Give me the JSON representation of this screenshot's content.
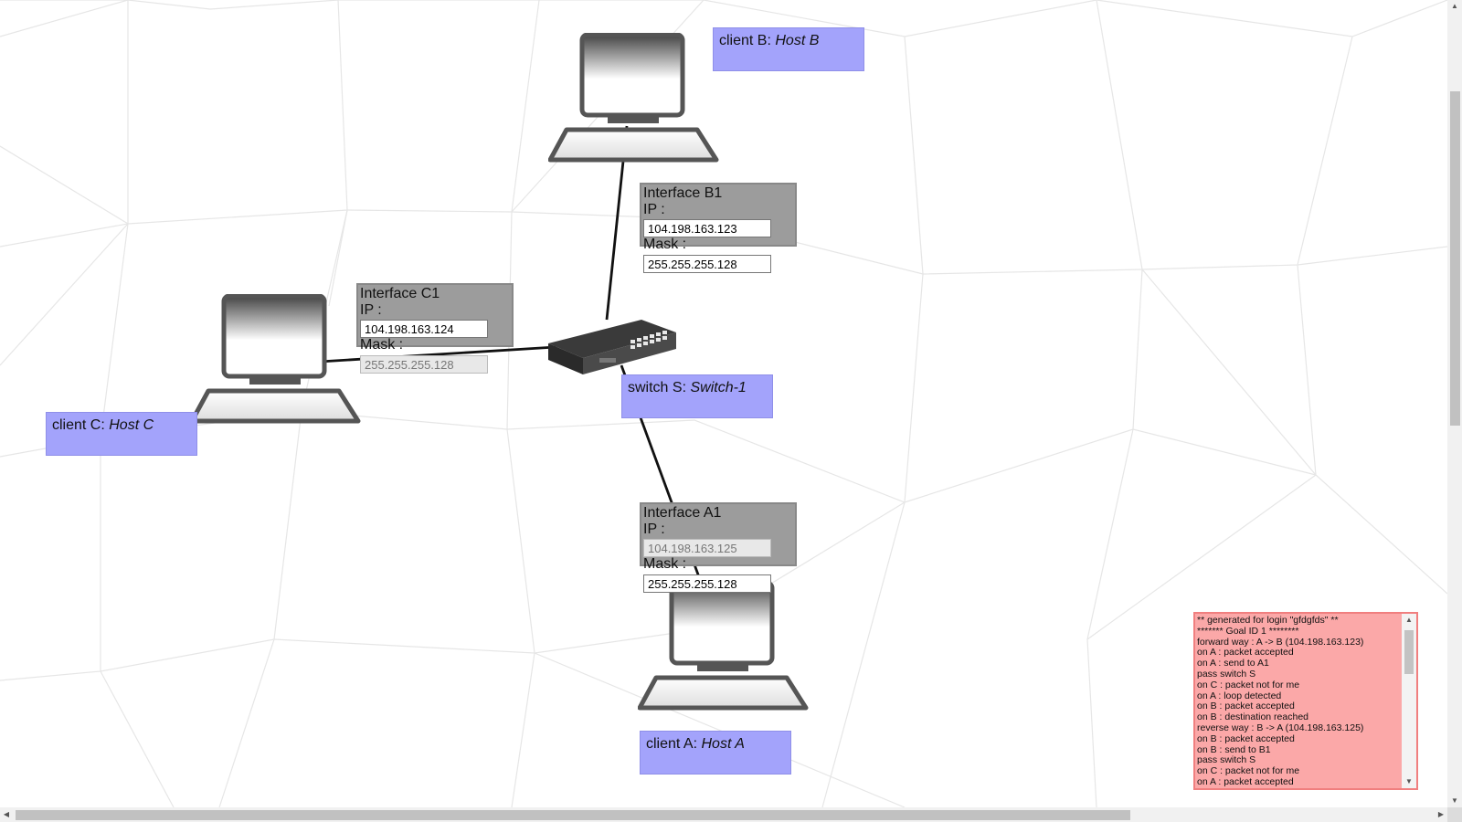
{
  "clients": [
    {
      "prefix": "client B: ",
      "name": "Host B"
    },
    {
      "prefix": "client C: ",
      "name": "Host C"
    },
    {
      "prefix": "client A: ",
      "name": "Host A"
    }
  ],
  "switch": {
    "prefix": "switch S: ",
    "name": "Switch-1"
  },
  "interfaces": [
    {
      "title": "Interface B1",
      "ip_label": "IP :",
      "ip": "104.198.163.123",
      "mask_label": "Mask :",
      "mask": "255.255.255.128"
    },
    {
      "title": "Interface C1",
      "ip_label": "IP :",
      "ip": "104.198.163.124",
      "mask_label": "Mask :",
      "mask": "255.255.255.128"
    },
    {
      "title": "Interface A1",
      "ip_label": "IP :",
      "ip": "104.198.163.125",
      "mask_label": "Mask :",
      "mask": "255.255.255.128"
    }
  ],
  "log": [
    "** generated for login \"gfdgfds\" **",
    "******* Goal ID 1 ********",
    "forward way : A -> B (104.198.163.123)",
    "on A : packet accepted",
    "on A : send to A1",
    "pass switch S",
    "on C : packet not for me",
    "on A : loop detected",
    "on B : packet accepted",
    "on B : destination reached",
    "reverse way : B -> A (104.198.163.125)",
    "on B : packet accepted",
    "on B : send to B1",
    "pass switch S",
    "on C : packet not for me",
    "on A : packet accepted"
  ],
  "colors": {
    "label_bg": "#a3a3fb",
    "iface_bg": "#9c9c9c",
    "log_bg": "#fba8a8",
    "log_border": "#f07f7f"
  }
}
